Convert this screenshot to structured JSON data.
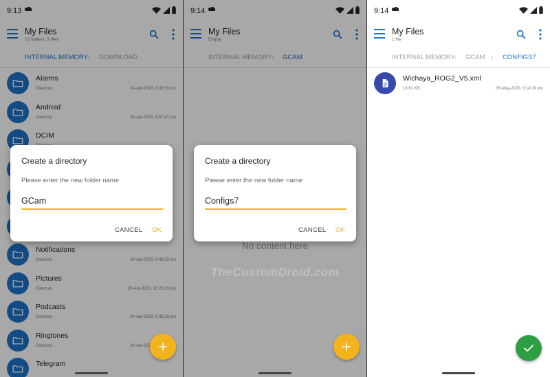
{
  "panels": [
    {
      "time": "9:13",
      "title": "My Files",
      "subtitle": "12 folders, 3 files",
      "breadcrumbs": [
        "INTERNAL MEMORY",
        "DOWNLOAD"
      ],
      "items": [
        {
          "name": "Alarms",
          "type": "Directory",
          "date": "24-Apr-2020, 8:45:53 pm"
        },
        {
          "name": "Android",
          "type": "Directory",
          "date": "24-Apr-2020, 9:57:47 pm"
        },
        {
          "name": "DCIM",
          "type": "Directory",
          "date": ""
        },
        {
          "name": "",
          "type": "",
          "date": ""
        },
        {
          "name": "",
          "type": "",
          "date": ""
        },
        {
          "name": "",
          "type": "",
          "date": ""
        },
        {
          "name": "Notifications",
          "type": "Directory",
          "date": "24-Apr-2020, 8:45:53 pm"
        },
        {
          "name": "Pictures",
          "type": "Directory",
          "date": "30-Apr-2020, 10:29:23 pm"
        },
        {
          "name": "Podcasts",
          "type": "Directory",
          "date": "24-Apr-2020, 8:45:53 pm"
        },
        {
          "name": "Ringtones",
          "type": "Directory",
          "date": "24-Apr-2020, 8:45:53 pm"
        },
        {
          "name": "Telegram",
          "type": "",
          "date": ""
        }
      ],
      "dialog": {
        "title": "Create a directory",
        "prompt": "Please enter the new folder name",
        "value": "GCam",
        "cancel": "CANCEL",
        "ok": "OK"
      }
    },
    {
      "time": "9:14",
      "title": "My Files",
      "subtitle": "Empty",
      "breadcrumbs": [
        "INTERNAL MEMORY",
        "GCAM"
      ],
      "empty_text": "No content here",
      "dialog": {
        "title": "Create a directory",
        "prompt": "Please enter the new folder name",
        "value": "Configs7",
        "cancel": "CANCEL",
        "ok": "OK"
      },
      "watermark": "TheCustomDroid.com"
    },
    {
      "time": "9:14",
      "title": "My Files",
      "subtitle": "1 file",
      "breadcrumbs": [
        "INTERNAL MEMORY",
        "GCAM",
        "CONFIGS7"
      ],
      "items": [
        {
          "name": "Wichaya_ROG2_V5.xml",
          "size": "10.61 KB",
          "date": "06-May-2020, 9:14:19 pm"
        }
      ]
    }
  ],
  "colors": {
    "accent": "#1e73c8",
    "fab": "#f2b31e",
    "confirm": "#2e9e44",
    "scrim": "rgba(0,0,0,0.34)"
  },
  "icons": [
    "menu-icon",
    "search-icon",
    "more-vert-icon",
    "folder-icon",
    "file-icon",
    "add-icon",
    "check-icon",
    "chevron-right-icon",
    "wifi-icon",
    "signal-icon",
    "battery-icon",
    "cloud-icon"
  ]
}
